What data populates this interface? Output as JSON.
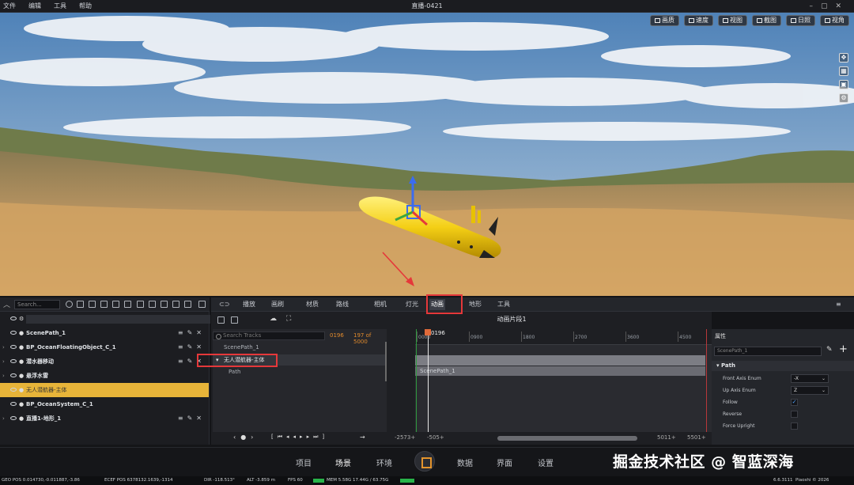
{
  "menubar": {
    "items": [
      "文件",
      "编辑",
      "工具",
      "帮助"
    ],
    "title": "直播-0421"
  },
  "viewport": {
    "buttons": [
      "画质",
      "速度",
      "视图",
      "截图",
      "日照",
      "视角"
    ]
  },
  "outliner": {
    "search_placeholder": "Search...",
    "items": [
      {
        "label": "ScenePath_1"
      },
      {
        "label": "BP_OceanFloatingObject_C_1"
      },
      {
        "label": "潜水器移动"
      },
      {
        "label": "悬浮水雷"
      },
      {
        "label": "无人潜航器-主体"
      },
      {
        "label": "BP_OceanSystem_C_1"
      },
      {
        "label": "直播1-地形_1"
      }
    ]
  },
  "tabs": [
    "播放",
    "画刷",
    "材质",
    "路线",
    "相机",
    "灯光",
    "动画",
    "地形",
    "工具"
  ],
  "sequencer": {
    "clip_title": "动画片段1",
    "search_placeholder": "Search Tracks",
    "current_frame": "0196",
    "frame_range": "197 of 5000",
    "tracks": [
      "ScenePath_1",
      "无人潜航器-主体",
      "Path"
    ],
    "playhead_label": "0196",
    "ruler_ticks": [
      "0000",
      "0900",
      "1800",
      "2700",
      "3600",
      "4500"
    ],
    "section_label": "ScenePath_1",
    "range_start": "-2573+",
    "range_view_start": "-505+",
    "range_view_end": "5011+",
    "range_end": "5501+"
  },
  "properties": {
    "header": "属性",
    "object_name": "ScenePath_1",
    "group": "Path",
    "rows": [
      {
        "label": "Front Axis Enum",
        "value": "-X"
      },
      {
        "label": "Up Axis Enum",
        "value": "Z"
      },
      {
        "label": "Follow",
        "checked": true
      },
      {
        "label": "Reverse",
        "checked": false
      },
      {
        "label": "Force Upright",
        "checked": false
      }
    ]
  },
  "bottomnav": {
    "items": [
      "项目",
      "场景",
      "环境",
      "数据",
      "界面",
      "设置"
    ],
    "watermark": "掘金技术社区 @ 智蓝深海"
  },
  "status": {
    "geo_pos": "GEO POS 0.014730,-0.011887,-3.86",
    "ecef_pos": "ECEF POS 6378132.1639,-1314",
    "dir": "DIR -118.513°",
    "alt": "ALT -3.859 m",
    "fps": "FPS 60",
    "mem": "MEM 5.58G 17.44G / 63.75G",
    "version": "6.6.3111",
    "copyright": "Piaoshi © 2026"
  },
  "colors": {
    "accent_selection": "#e7b439",
    "annotation_red": "#e5383a",
    "frame_orange": "#e08a2c"
  }
}
